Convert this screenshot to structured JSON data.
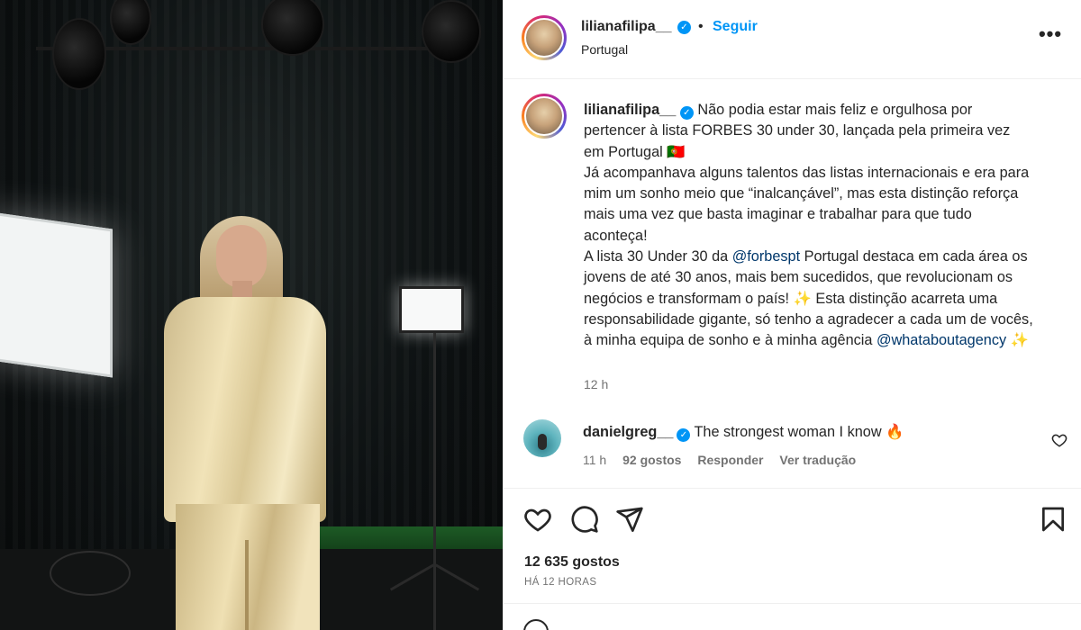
{
  "post": {
    "username": "lilianafilipa__",
    "follow_label": "Seguir",
    "separator": "•",
    "location": "Portugal",
    "more_label": "•••"
  },
  "caption": {
    "username": "lilianafilipa__",
    "part1": "Não podia estar mais feliz e orgulhosa por pertencer à lista FORBES 30 under 30, lançada pela primeira vez em Portugal 🇵🇹\nJá acompanhava alguns talentos das listas internacionais e era para mim um sonho meio que “inalcançável”, mas esta distinção reforça mais uma vez que basta imaginar e trabalhar para que tudo aconteça!\nA lista 30 Under 30 da ",
    "mention1": "@forbespt",
    "part2": " Portugal destaca em cada área os jovens de até 30 anos, mais bem sucedidos, que revolucionam os negócios e transformam o país! ",
    "sparkle1": "✨",
    "part3": " Esta distinção acarreta uma responsabilidade gigante, só tenho a agradecer a cada um de vocês, à minha equipa de sonho e à minha agência ",
    "mention2": "@whataboutagency",
    "sparkle2": "✨",
    "time": "12 h"
  },
  "comment": {
    "username": "danielgreg__",
    "text": "The strongest woman I know",
    "emoji": "🔥",
    "time": "11 h",
    "likes": "92 gostos",
    "reply_label": "Responder",
    "translate_label": "Ver tradução"
  },
  "actions": {
    "likes_count": "12 635 gostos",
    "time_ago": "HÁ 12 HORAS"
  },
  "icons": {
    "like": "heart-icon",
    "comment": "comment-bubble-icon",
    "share": "paper-plane-icon",
    "save": "bookmark-icon",
    "more": "more-options-icon",
    "verified": "verified-badge-icon",
    "emoji": "emoji-icon"
  },
  "colors": {
    "link_blue": "#0095f6",
    "mention_blue": "#00376b",
    "secondary_text": "#737373",
    "primary_text": "#262626"
  }
}
